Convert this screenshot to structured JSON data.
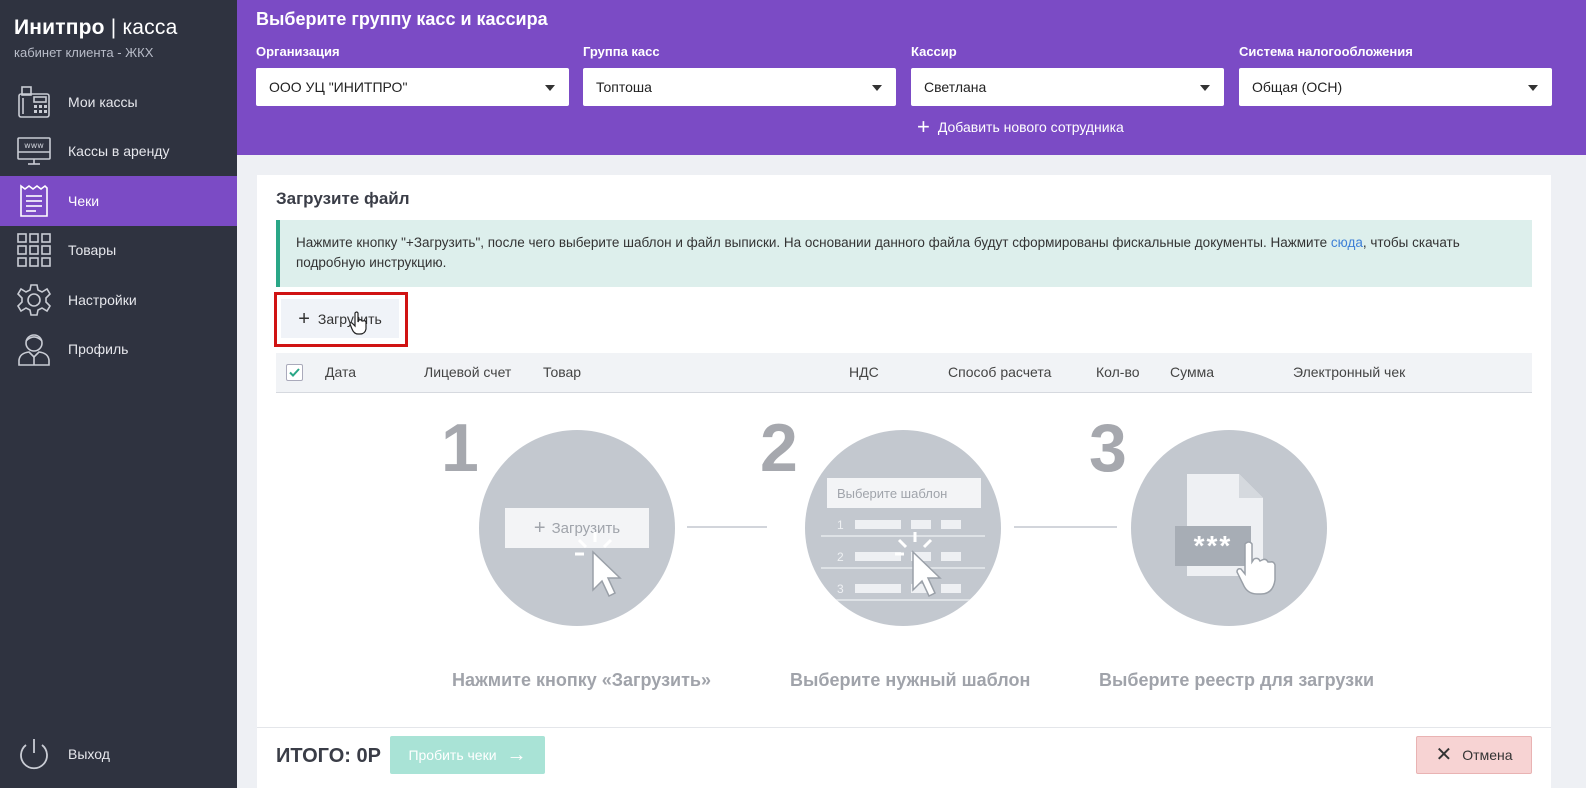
{
  "brand": {
    "name_bold": "Инитпро",
    "name_sep": " | ",
    "name_rest": "касса",
    "subtitle": "кабинет клиента - ЖКХ"
  },
  "sidebar": {
    "items": [
      {
        "label": "Мои кассы",
        "icon": "cash-register-icon"
      },
      {
        "label": "Кассы в аренду",
        "icon": "www-monitor-icon"
      },
      {
        "label": "Чеки",
        "icon": "receipt-icon",
        "active": true
      },
      {
        "label": "Товары",
        "icon": "grid-icon"
      },
      {
        "label": "Настройки",
        "icon": "gear-icon"
      },
      {
        "label": "Профиль",
        "icon": "user-icon"
      }
    ],
    "exit_label": "Выход"
  },
  "header": {
    "title": "Выберите группу касс и кассира",
    "fields": [
      {
        "label": "Организация",
        "value": "ООО УЦ \"ИНИТПРО\""
      },
      {
        "label": "Группа касс",
        "value": "Топтоша"
      },
      {
        "label": "Кассир",
        "value": "Светлана"
      },
      {
        "label": "Система налогообложения",
        "value": "Общая (ОСН)"
      }
    ],
    "add_employee": "Добавить нового сотрудника"
  },
  "main": {
    "title": "Загрузите файл",
    "info_text": "Нажмите кнопку \"+Загрузить\", после чего выберите шаблон и файл выписки. На основании данного файла будут сформированы фискальные документы. Нажмите ",
    "info_link": "сюда",
    "info_text_end": ", чтобы скачать подробную инструкцию.",
    "upload_label": "Загрузить",
    "table_headers": [
      "Дата",
      "Лицевой счет",
      "Товар",
      "НДС",
      "Способ расчета",
      "Кол-во",
      "Сумма",
      "Электронный чек"
    ],
    "steps": [
      {
        "number": "1",
        "caption": "Нажмите кнопку «Загрузить»",
        "illustration_button": "Загрузить"
      },
      {
        "number": "2",
        "caption": "Выберите нужный шаблон",
        "illustration_select": "Выберите шаблон",
        "rows": [
          "1",
          "2",
          "3"
        ]
      },
      {
        "number": "3",
        "caption": "Выберите реестр для загрузки",
        "illustration_mask": "***"
      }
    ]
  },
  "footer": {
    "total": "ИТОГО: 0Р",
    "process_label": "Пробить чеки",
    "cancel_label": "Отмена"
  },
  "colors": {
    "accent": "#7b4bc5",
    "sidebar": "#2f3340",
    "info_bg": "#ddefec",
    "info_border": "#2aa787",
    "highlight": "#d01313"
  }
}
